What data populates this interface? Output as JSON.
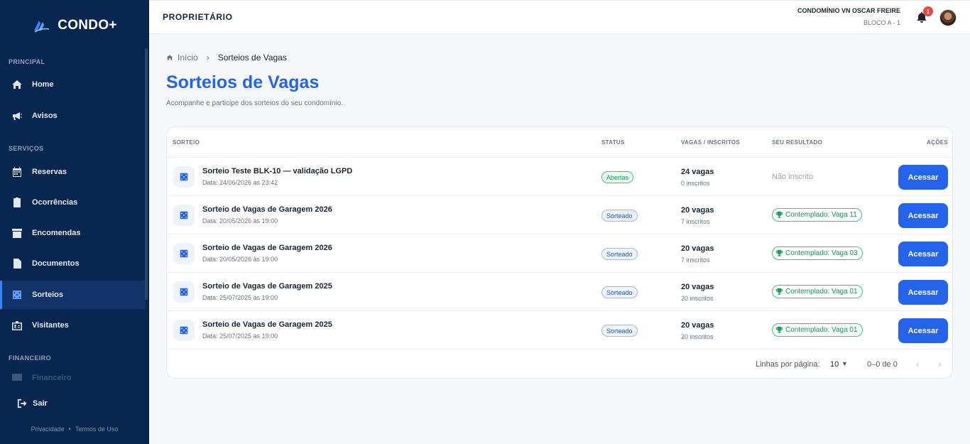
{
  "app": {
    "name": "CONDO+"
  },
  "sidebar": {
    "sections": [
      {
        "label": "PRINCIPAL"
      },
      {
        "label": "SERVIÇOS"
      },
      {
        "label": "FINANCEIRO"
      }
    ],
    "items": [
      {
        "label": "Home",
        "icon": "home-icon"
      },
      {
        "label": "Avisos",
        "icon": "megaphone-icon"
      },
      {
        "label": "Reservas",
        "icon": "calendar-icon"
      },
      {
        "label": "Ocorrências",
        "icon": "clipboard-icon"
      },
      {
        "label": "Encomendas",
        "icon": "archive-box-icon"
      },
      {
        "label": "Documentos",
        "icon": "document-icon"
      },
      {
        "label": "Sorteios",
        "icon": "dice-icon",
        "active": true
      },
      {
        "label": "Visitantes",
        "icon": "visitor-badge-icon"
      },
      {
        "label": "Financeiro",
        "icon": "wallet-icon"
      }
    ],
    "logout": "Sair",
    "footer": {
      "privacy": "Privacidade",
      "terms": "Termos de Uso",
      "separator": "•"
    }
  },
  "topbar": {
    "role": "PROPRIETÁRIO",
    "condo": "CONDOMÍNIO VN OSCAR FREIRE",
    "unit": "BLOCO A - 1",
    "notifications": "1"
  },
  "breadcrumb": {
    "home": "Início",
    "separator": "›",
    "current": "Sorteios de Vagas"
  },
  "page": {
    "title": "Sorteios de Vagas",
    "subtitle": "Acompanhe e participe dos sorteios do seu condomínio."
  },
  "table": {
    "headers": {
      "sorteio": "SORTEIO",
      "status": "STATUS",
      "vagas": "VAGAS / INSCRITOS",
      "resultado": "SEU RESULTADO",
      "acoes": "AÇÕES"
    },
    "rows": [
      {
        "title": "Sorteio Teste BLK-10 — validação LGPD",
        "date": "Data: 24/06/2026 às 23:42",
        "status": "Abertas",
        "vagas": "24 vagas",
        "inscritos": "0 inscritos",
        "result": "Não inscrito",
        "won": false,
        "action": "Acessar"
      },
      {
        "title": "Sorteio de Vagas de Garagem 2026",
        "date": "Data: 20/05/2026 às 19:00",
        "status": "Sorteado",
        "vagas": "20 vagas",
        "inscritos": "7 inscritos",
        "result": "Contemplado: Vaga 11",
        "won": true,
        "action": "Acessar"
      },
      {
        "title": "Sorteio de Vagas de Garagem 2026",
        "date": "Data: 20/05/2026 às 19:00",
        "status": "Sorteado",
        "vagas": "20 vagas",
        "inscritos": "7 inscritos",
        "result": "Contemplado: Vaga 03",
        "won": true,
        "action": "Acessar"
      },
      {
        "title": "Sorteio de Vagas de Garagem 2025",
        "date": "Data: 25/07/2025 às 19:00",
        "status": "Sorteado",
        "vagas": "20 vagas",
        "inscritos": "20 inscritos",
        "result": "Contemplado: Vaga 01",
        "won": true,
        "action": "Acessar"
      },
      {
        "title": "Sorteio de Vagas de Garagem 2025",
        "date": "Data: 25/07/2025 às 19:00",
        "status": "Sorteado",
        "vagas": "20 vagas",
        "inscritos": "20 inscritos",
        "result": "Contemplado: Vaga 01",
        "won": true,
        "action": "Acessar"
      }
    ]
  },
  "pagination": {
    "label": "Linhas por página:",
    "per_page": "10",
    "range": "0–0 de 0"
  },
  "colors": {
    "sidebar": "#08264f",
    "accent": "#2563eb",
    "success": "#14924f"
  }
}
